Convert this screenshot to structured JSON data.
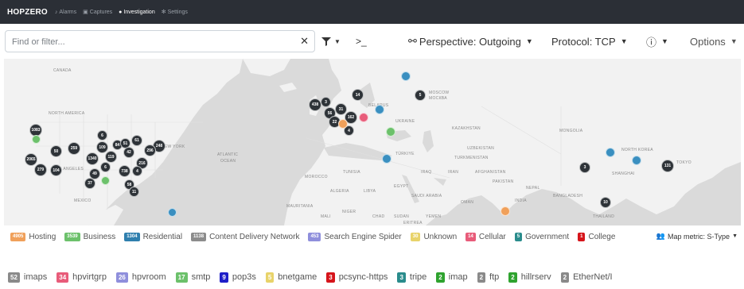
{
  "navbar": {
    "brand": "HOPZERO",
    "items": [
      {
        "label": "Alarms",
        "icon": "bell-icon"
      },
      {
        "label": "Captures",
        "icon": "camera-icon"
      },
      {
        "label": "Investigation",
        "icon": "map-pin-icon",
        "active": true
      },
      {
        "label": "Settings",
        "icon": "gear-icon"
      }
    ]
  },
  "toolbar": {
    "search_placeholder": "Find or filter...",
    "clear_glyph": "✕",
    "filter_icon": "funnel-icon",
    "terminal_glyph": ">_",
    "perspective_label": "Perspective: Outgoing",
    "protocol_label": "Protocol: TCP",
    "info_glyph": "ⓘ",
    "options_label": "Options"
  },
  "map": {
    "labels": [
      {
        "text": "CANADA"
      },
      {
        "text": "NORTH AMERICA"
      },
      {
        "text": "NEW YORK"
      },
      {
        "text": "LOS ANGELES"
      },
      {
        "text": "MEXICO"
      },
      {
        "text": "KAZAKHSTAN"
      },
      {
        "text": "MONGOLIA"
      },
      {
        "text": "MOSCOW"
      },
      {
        "text": "МОСКВА"
      },
      {
        "text": "BELARUS"
      },
      {
        "text": "UKRAINE"
      },
      {
        "text": "TÜRKIYE"
      },
      {
        "text": "IRAQ"
      },
      {
        "text": "IRAN"
      },
      {
        "text": "AFGHANISTAN"
      },
      {
        "text": "PAKISTAN"
      },
      {
        "text": "ALGERIA"
      },
      {
        "text": "LIBYA"
      },
      {
        "text": "EGYPT"
      },
      {
        "text": "SAUDI ARABIA"
      },
      {
        "text": "MAURITANIA"
      },
      {
        "text": "MALI"
      },
      {
        "text": "NIGER"
      },
      {
        "text": "CHAD"
      },
      {
        "text": "SUDAN"
      },
      {
        "text": "YEMEN"
      },
      {
        "text": "INDIA"
      },
      {
        "text": "NEPAL"
      },
      {
        "text": "BANGLADESH"
      },
      {
        "text": "THAILAND"
      },
      {
        "text": "SHANGHAI"
      },
      {
        "text": "TOKYO"
      },
      {
        "text": "NORTH KOREA"
      },
      {
        "text": "MOROCCO"
      },
      {
        "text": "TUNISIA"
      },
      {
        "text": "UZBEKISTAN"
      },
      {
        "text": "TURKMENISTAN"
      },
      {
        "text": "OMAN"
      },
      {
        "text": "ERITREA"
      },
      {
        "text": "ATLANTIC"
      },
      {
        "text": "OCEAN"
      }
    ],
    "clusters": [
      {
        "count": "1083"
      },
      {
        "count": "6"
      },
      {
        "count": "50"
      },
      {
        "count": "259"
      },
      {
        "count": "109"
      },
      {
        "count": "84"
      },
      {
        "count": "51"
      },
      {
        "count": "61"
      },
      {
        "count": "42"
      },
      {
        "count": "248"
      },
      {
        "count": "296"
      },
      {
        "count": "1340"
      },
      {
        "count": "119"
      },
      {
        "count": "216"
      },
      {
        "count": "2065"
      },
      {
        "count": "6"
      },
      {
        "count": "279"
      },
      {
        "count": "104"
      },
      {
        "count": "49"
      },
      {
        "count": "738"
      },
      {
        "count": "4"
      },
      {
        "count": "37"
      },
      {
        "count": "58"
      },
      {
        "count": "11"
      },
      {
        "count": "438"
      },
      {
        "count": "3"
      },
      {
        "count": "56"
      },
      {
        "count": "31"
      },
      {
        "count": "162"
      },
      {
        "count": "22"
      },
      {
        "count": "14"
      },
      {
        "count": "5"
      },
      {
        "count": "3"
      },
      {
        "count": "131"
      },
      {
        "count": "10"
      },
      {
        "count": "4"
      }
    ],
    "colors": {
      "cluster": "#2e3338",
      "hosting": "#f0a05a",
      "business": "#6cc16b",
      "residential": "#3a8fc0",
      "cellular": "#e85c7a"
    }
  },
  "legend": {
    "items": [
      {
        "count": "4905",
        "label": "Hosting",
        "color": "#f0a05a"
      },
      {
        "count": "3539",
        "label": "Business",
        "color": "#6cc16b"
      },
      {
        "count": "1304",
        "label": "Residential",
        "color": "#2f7fae"
      },
      {
        "count": "1138",
        "label": "Content Delivery Network",
        "color": "#8c8c8c"
      },
      {
        "count": "453",
        "label": "Search Engine Spider",
        "color": "#8f8fdc"
      },
      {
        "count": "30",
        "label": "Unknown",
        "color": "#e8d36a"
      },
      {
        "count": "14",
        "label": "Cellular",
        "color": "#e85c7a"
      },
      {
        "count": "5",
        "label": "Government",
        "color": "#2a8c8c"
      },
      {
        "count": "1",
        "label": "College",
        "color": "#d6151b"
      }
    ],
    "metric_label": "Map metric: S-Type",
    "metric_icon": "users-icon"
  },
  "protocols": [
    {
      "count": "52",
      "label": "imaps",
      "color": "#8a8a8a"
    },
    {
      "count": "34",
      "label": "hpvirtgrp",
      "color": "#e85c7a"
    },
    {
      "count": "26",
      "label": "hpvroom",
      "color": "#8f8fdc"
    },
    {
      "count": "17",
      "label": "smtp",
      "color": "#6cc16b"
    },
    {
      "count": "9",
      "label": "pop3s",
      "color": "#1f1fc8"
    },
    {
      "count": "5",
      "label": "bnetgame",
      "color": "#e8d36a"
    },
    {
      "count": "3",
      "label": "pcsync-https",
      "color": "#d6151b"
    },
    {
      "count": "3",
      "label": "tripe",
      "color": "#2a8c8c"
    },
    {
      "count": "2",
      "label": "imap",
      "color": "#2fa32f"
    },
    {
      "count": "2",
      "label": "ftp",
      "color": "#8a8a8a"
    },
    {
      "count": "2",
      "label": "hillrserv",
      "color": "#2fa32f"
    },
    {
      "count": "2",
      "label": "EtherNet/I",
      "color": "#8a8a8a"
    }
  ]
}
